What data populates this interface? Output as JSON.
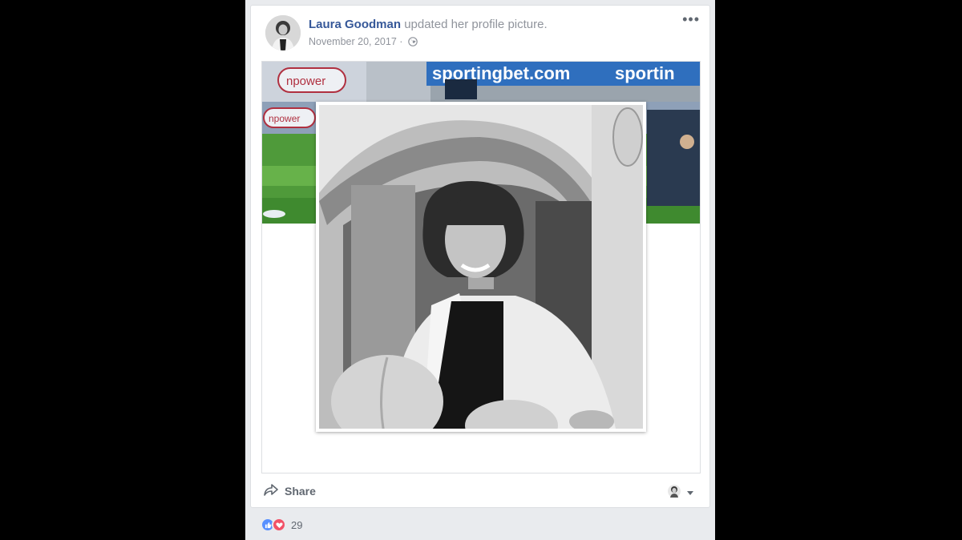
{
  "post": {
    "author": "Laura Goodman",
    "action_text": "updated her profile picture.",
    "date": "November 20, 2017",
    "separator": "·",
    "more_label": "•••",
    "privacy_icon": "globe-icon"
  },
  "media": {
    "cover_banner_text": "sportingbet.com",
    "cover_banner_text_2": "sportin",
    "cover_sign_1": "npower",
    "cover_sign_2": "npower"
  },
  "actions": {
    "share_label": "Share",
    "share_icon": "share-arrow-icon",
    "reaction_avatar_icon": "reactor-avatar-icon",
    "dropdown_icon": "caret-down-icon"
  },
  "footer": {
    "reactions": [
      "like-icon",
      "love-icon"
    ],
    "reaction_count": "29"
  },
  "colors": {
    "author": "#365899",
    "meta": "#90949c",
    "like": "#5890ff",
    "love": "#f25268",
    "banner_blue": "#2f6fbe"
  }
}
